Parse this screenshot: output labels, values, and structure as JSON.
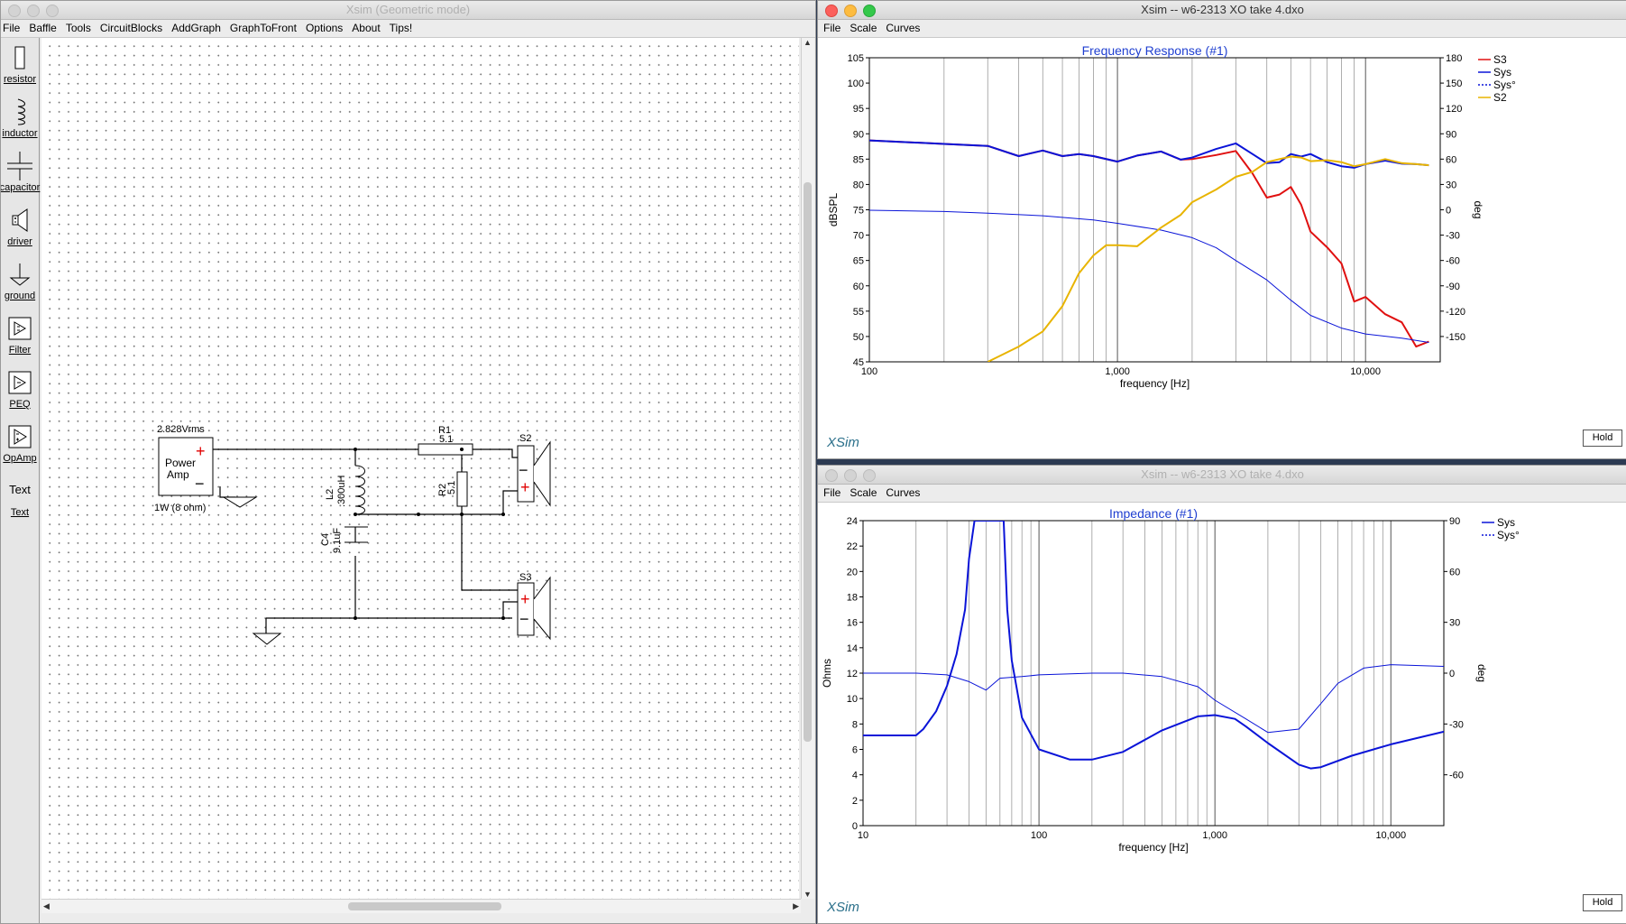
{
  "schematic": {
    "title": "Xsim (Geometric mode)",
    "menus": [
      "File",
      "Baffle",
      "Tools",
      "CircuitBlocks",
      "AddGraph",
      "GraphToFront",
      "Options",
      "About",
      "Tips!"
    ],
    "palette": [
      {
        "label": "resistor",
        "icon": "resistor-icon"
      },
      {
        "label": "inductor",
        "icon": "inductor-icon"
      },
      {
        "label": "capacitor",
        "icon": "capacitor-icon"
      },
      {
        "label": "driver",
        "icon": "driver-icon"
      },
      {
        "label": "ground",
        "icon": "ground-icon"
      },
      {
        "label": "Filter",
        "icon": "filter-icon"
      },
      {
        "label": "PEQ",
        "icon": "peq-icon"
      },
      {
        "label": "OpAmp",
        "icon": "opamp-icon"
      },
      {
        "label": "Text",
        "icon": "text-icon",
        "icon_text": "Text"
      }
    ],
    "circuit": {
      "source_voltage": "2.828Vrms",
      "amp_line1": "Power",
      "amp_line2": "Amp",
      "amp_rating": "1W (8 ohm)",
      "r1_name": "R1",
      "r1_value": "5.1",
      "r2_name": "R2",
      "r2_value": "5.1",
      "l2_name": "L2",
      "l2_value": ".300uH",
      "c4_name": "C4",
      "c4_value": "9.1uF",
      "s2_name": "S2",
      "s3_name": "S3",
      "plus": "+",
      "minus": "−"
    }
  },
  "freq_window": {
    "title": "Xsim -- w6-2313 XO take 4.dxo",
    "menus": [
      "File",
      "Scale",
      "Curves"
    ],
    "hold_label": "Hold",
    "brand": "XSim"
  },
  "imp_window": {
    "title": "Xsim -- w6-2313 XO take 4.dxo",
    "menus": [
      "File",
      "Scale",
      "Curves"
    ],
    "hold_label": "Hold",
    "brand": "XSim"
  },
  "colors": {
    "s3": "#e01010",
    "sys": "#0a14d8",
    "s2": "#e8b400",
    "title": "#1f3fd0"
  },
  "chart_data": [
    {
      "type": "line",
      "title": "Frequency Response (#1)",
      "xlabel": "frequency [Hz]",
      "ylabel": "dBSPL",
      "y2label": "deg",
      "xscale": "log",
      "xlim": [
        100,
        20000
      ],
      "ylim": [
        45,
        105
      ],
      "y2lim": [
        -180,
        180
      ],
      "xticks": [
        "100",
        "1,000",
        "10,000"
      ],
      "yticks": [
        "45",
        "50",
        "55",
        "60",
        "65",
        "70",
        "75",
        "80",
        "85",
        "90",
        "95",
        "100",
        "105"
      ],
      "y2ticks": [
        "180",
        "150",
        "120",
        "90",
        "60",
        "30",
        "0",
        "-30",
        "-60",
        "-90",
        "-120",
        "-150"
      ],
      "legend_position": "right",
      "series": [
        {
          "name": "S3",
          "axis": "left",
          "x": [
            100,
            200,
            300,
            400,
            500,
            600,
            700,
            800,
            1000,
            1200,
            1500,
            1800,
            2000,
            2500,
            3000,
            3500,
            4000,
            4500,
            5000,
            5500,
            6000,
            7000,
            8000,
            9000,
            10000,
            12000,
            14000,
            16000,
            18000
          ],
          "values": [
            88.7,
            88,
            87.6,
            85.6,
            86.7,
            85.6,
            86,
            85.6,
            84.5,
            85.7,
            86.5,
            84.9,
            85,
            85.8,
            86.6,
            82.2,
            77.4,
            78,
            79.5,
            76,
            70.7,
            67.6,
            64.4,
            56.9,
            57.8,
            54.4,
            52.8,
            48,
            49
          ]
        },
        {
          "name": "Sys",
          "axis": "left",
          "x": [
            100,
            200,
            300,
            400,
            500,
            600,
            700,
            800,
            1000,
            1200,
            1500,
            1800,
            2000,
            2500,
            3000,
            3500,
            4000,
            4500,
            5000,
            5500,
            6000,
            7000,
            8000,
            9000,
            10000,
            12000,
            14000,
            16000,
            18000
          ],
          "values": [
            88.7,
            88,
            87.6,
            85.6,
            86.7,
            85.6,
            86,
            85.6,
            84.5,
            85.7,
            86.5,
            84.9,
            85.3,
            87,
            88.1,
            86,
            84.2,
            84.4,
            86,
            85.5,
            86,
            84.4,
            83.6,
            83.3,
            84,
            84.7,
            84.1,
            84,
            83.8
          ]
        },
        {
          "name": "Sys°",
          "axis": "right",
          "x": [
            100,
            200,
            300,
            500,
            800,
            1000,
            1500,
            2000,
            2500,
            3000,
            4000,
            5000,
            6000,
            8000,
            10000,
            14000,
            18000
          ],
          "values": [
            -0.5,
            -2,
            -4,
            -7,
            -12,
            -16,
            -24,
            -33,
            -45,
            -60,
            -83,
            -107,
            -125,
            -140,
            -147,
            -152,
            -157
          ]
        },
        {
          "name": "S2",
          "axis": "left",
          "x": [
            300,
            400,
            500,
            600,
            700,
            800,
            900,
            1000,
            1200,
            1500,
            1800,
            2000,
            2500,
            3000,
            3500,
            4000,
            4500,
            5000,
            5500,
            6000,
            7000,
            8000,
            9000,
            10000,
            12000,
            14000,
            16000,
            18000
          ],
          "values": [
            45,
            48,
            51,
            56,
            62.5,
            66,
            68,
            68,
            67.8,
            71.5,
            74,
            76.5,
            79,
            81.5,
            82.5,
            84.4,
            85,
            85.5,
            85.3,
            84.6,
            84.8,
            84.4,
            83.6,
            84,
            85,
            84.2,
            84,
            83.8
          ]
        }
      ]
    },
    {
      "type": "line",
      "title": "Impedance (#1)",
      "xlabel": "frequency [Hz]",
      "ylabel": "Ohms",
      "y2label": "deg",
      "xscale": "log",
      "xlim": [
        10,
        20000
      ],
      "ylim": [
        0,
        24
      ],
      "y2lim": [
        -90,
        90
      ],
      "xticks": [
        "10",
        "100",
        "1,000",
        "10,000"
      ],
      "yticks": [
        "0",
        "2",
        "4",
        "6",
        "8",
        "10",
        "12",
        "14",
        "16",
        "18",
        "20",
        "22",
        "24"
      ],
      "y2ticks": [
        "90",
        "60",
        "30",
        "0",
        "-30",
        "-60"
      ],
      "legend_position": "right",
      "series": [
        {
          "name": "Sys",
          "axis": "left",
          "x": [
            10,
            20,
            22,
            26,
            30,
            34,
            38,
            40,
            43,
            47,
            52,
            58,
            63,
            66,
            70,
            80,
            100,
            150,
            200,
            300,
            500,
            800,
            1000,
            1300,
            1500,
            2000,
            3000,
            3500,
            4000,
            6000,
            10000,
            20000
          ],
          "values": [
            7.1,
            7.1,
            7.6,
            9,
            11,
            13.5,
            17,
            21,
            24,
            24,
            24,
            24,
            24,
            17,
            13,
            8.5,
            6,
            5.2,
            5.2,
            5.8,
            7.5,
            8.6,
            8.7,
            8.4,
            7.8,
            6.5,
            4.8,
            4.5,
            4.6,
            5.5,
            6.4,
            7.4
          ]
        },
        {
          "name": "Sys°",
          "axis": "right",
          "x": [
            10,
            20,
            30,
            40,
            50,
            60,
            80,
            100,
            200,
            300,
            500,
            800,
            1000,
            1500,
            2000,
            3000,
            4000,
            5000,
            7000,
            10000,
            20000
          ],
          "values": [
            0,
            0,
            -1,
            -5,
            -10,
            -3,
            -2,
            -1,
            0,
            0,
            -2,
            -8,
            -16,
            -27,
            -35,
            -33,
            -18,
            -6,
            3,
            5,
            4
          ]
        }
      ]
    }
  ]
}
